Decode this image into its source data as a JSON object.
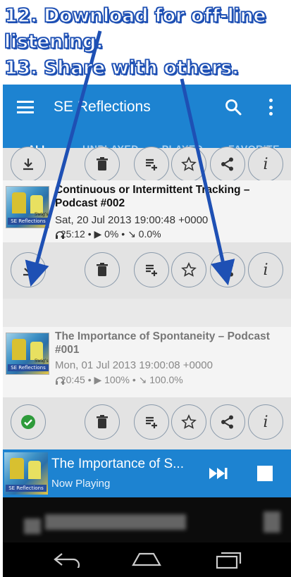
{
  "annotation": {
    "lines": [
      "12. Download for off-line",
      "listening.",
      "13. Share with others."
    ]
  },
  "appbar": {
    "title": "SE Reflections",
    "menu_icon": "hamburger-menu-icon",
    "search_icon": "search-icon",
    "overflow_icon": "overflow-menu-icon"
  },
  "tabs": [
    "ALL",
    "UNPLAYED",
    "PLAYED",
    "FAVORITE"
  ],
  "episodes": [
    {
      "title": "Continuous or Intermittent Tracking – Podcast #002",
      "date": "Sat, 20 Jul 2013 19:00:48 +0000",
      "meta": "  25:12 • ▶ 0% • ↘ 0.0%",
      "thumb_label": "SE Reflections",
      "thumb_small": "Swig's",
      "download_state": "download"
    },
    {
      "title": "The Importance of Spontaneity – Podcast #001",
      "date": "Mon, 01 Jul 2013 19:00:08 +0000",
      "meta": "  20:45 • ▶ 100% • ↘ 100.0%",
      "thumb_label": "SE Reflections",
      "thumb_small": "Swig's",
      "download_state": "downloaded"
    }
  ],
  "player": {
    "title": "The Importance of S...",
    "subtitle": "Now Playing",
    "thumb_label": "SE Reflections"
  },
  "colors": {
    "primary": "#1d83d1",
    "annotation_stroke": "#1e50b4",
    "downloaded_green": "#2e9b3a"
  }
}
